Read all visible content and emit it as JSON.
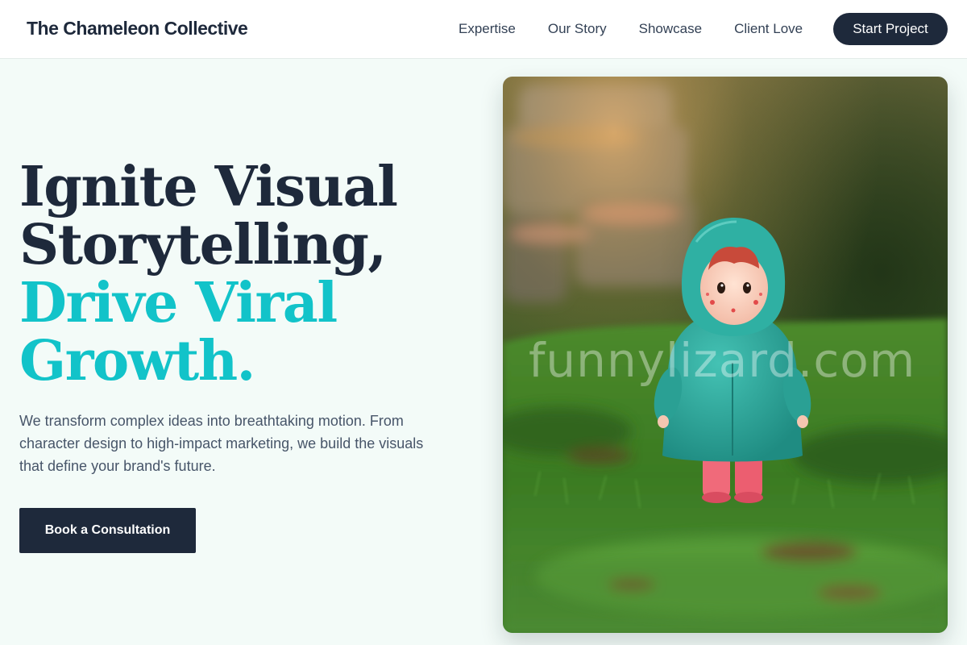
{
  "header": {
    "brand": "The Chameleon Collective",
    "nav": [
      "Expertise",
      "Our Story",
      "Showcase",
      "Client Love"
    ],
    "cta": "Start Project"
  },
  "hero": {
    "title_line1": "Ignite Visual",
    "title_line2": "Storytelling,",
    "title_line3": "Drive Viral",
    "title_line4": "Growth.",
    "description": "We transform complex ideas into breathtaking motion. From character design to high-impact marketing, we build the visuals that define your brand's future.",
    "cta": "Book a Consultation"
  },
  "image": {
    "watermark": "funnylizard.com"
  },
  "colors": {
    "primary_dark": "#1e293b",
    "accent_teal": "#12c3c9",
    "page_background": "#f3fbf8"
  }
}
